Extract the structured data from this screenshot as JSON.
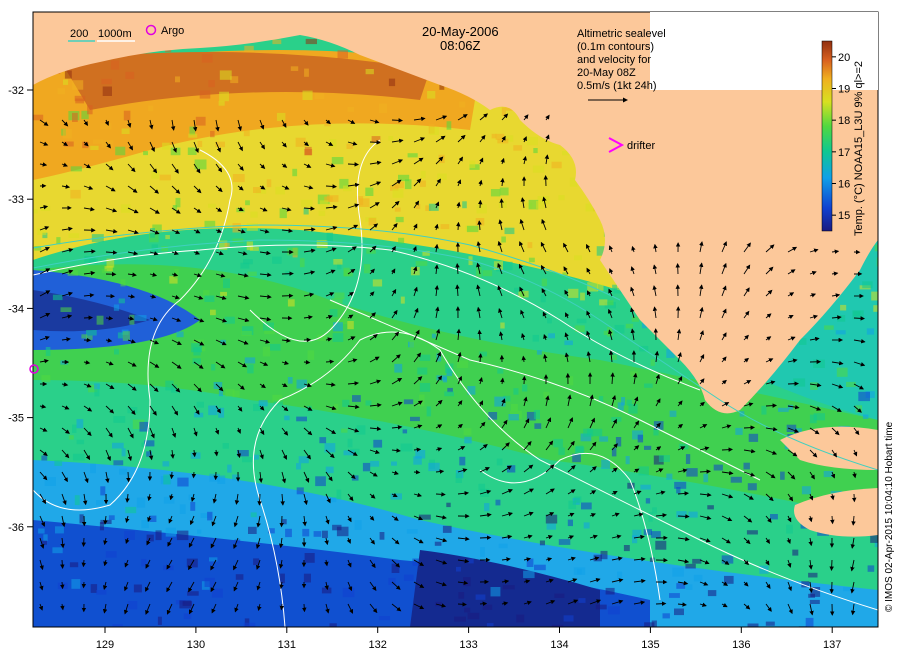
{
  "title": {
    "date": "20-May-2006",
    "time": "08:06Z"
  },
  "legend": {
    "depth_200": "200",
    "depth_1000": "1000m",
    "argo": "Argo",
    "drifter": "drifter",
    "argo_color": "#e000e0",
    "drifter_color": "#ff00ff",
    "contour_colors": {
      "200": "#40d0c0",
      "1000": "#ffffff"
    }
  },
  "altimetry_note": [
    "Altimetric sealevel",
    "(0.1m contours)",
    "and velocity for",
    "20-May 08Z",
    "0.5m/s (1kt 24h)"
  ],
  "colorbar": {
    "label": "Temp. (°C) NOAA15_L3U 9% ql>=2",
    "ticks": [
      "15",
      "16",
      "17",
      "18",
      "19",
      "20"
    ],
    "min": 14.5,
    "max": 20.5,
    "colors": [
      "#1a1a80",
      "#1040d0",
      "#10a0e8",
      "#10c890",
      "#50d840",
      "#d8e020",
      "#f0b020",
      "#d86020",
      "#903010"
    ]
  },
  "axes": {
    "x_ticks": [
      "129",
      "130",
      "131",
      "132",
      "133",
      "134",
      "135",
      "136",
      "137"
    ],
    "y_ticks": [
      "-32",
      "-33",
      "-34",
      "-35",
      "-36"
    ]
  },
  "credit": "© IMOS 02-Apr-2015 10:04:10 Hobart time",
  "land_color": "#fcc89a"
}
